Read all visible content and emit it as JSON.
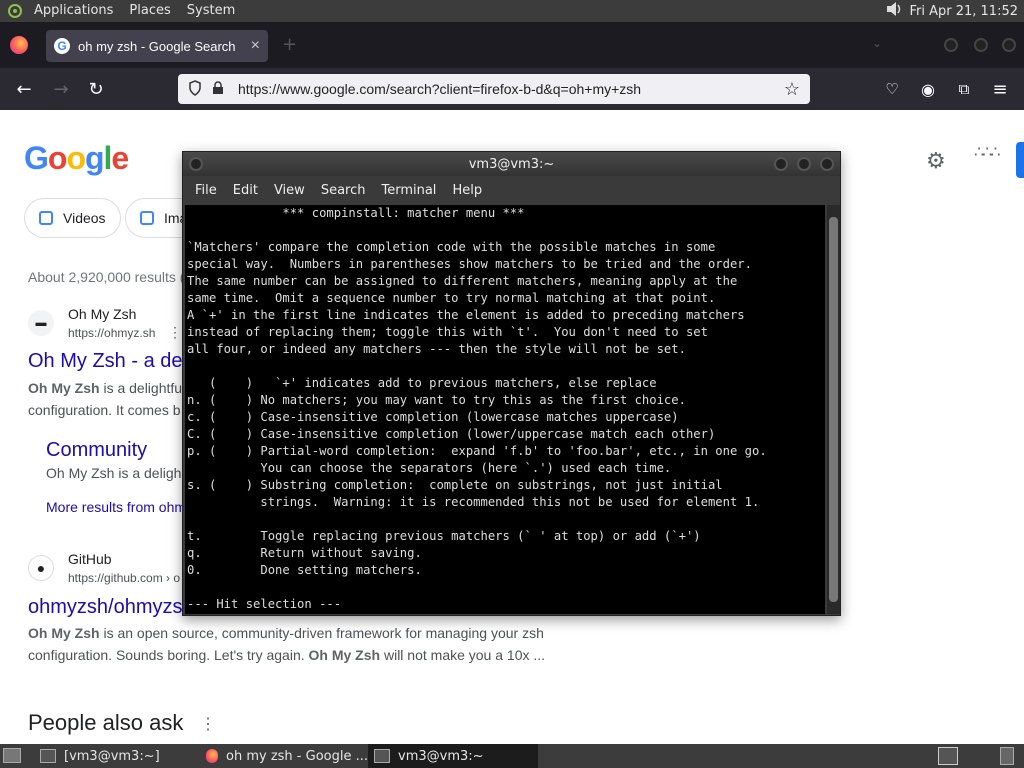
{
  "topbar": {
    "menus": [
      "Applications",
      "Places",
      "System"
    ],
    "clock": "Fri Apr 21, 11:52"
  },
  "browser": {
    "tab_title": "oh my zsh - Google Search",
    "url": "https://www.google.com/search?client=firefox-b-d&q=oh+my+zsh"
  },
  "google": {
    "logo": "Google",
    "chips": [
      "Videos",
      "Ima"
    ],
    "about": "About 2,920,000 results (",
    "result1": {
      "site_name": "Oh My Zsh",
      "site_url": "https://ohmyz.sh",
      "title": "Oh My Zsh - a de",
      "snippet_bold": "Oh My Zsh",
      "snippet_rest": " is a delightfu",
      "snippet_line2": "configuration. It comes b",
      "sublink_title": "Community",
      "sublink_snippet": "Oh My Zsh is a deligh",
      "more_results": "More results from ohm"
    },
    "result2": {
      "site_name": "GitHub",
      "site_url": "https://github.com › o",
      "title": "ohmyzsh/ohmyzs",
      "line1_bold": "Oh My Zsh",
      "line1_rest": " is an open source, community-driven framework for managing your zsh",
      "line2_a": "configuration. Sounds boring. Let's try again. ",
      "line2_bold": "Oh My Zsh",
      "line2_b": " will not make you a 10x ..."
    },
    "people_also_ask": "People also ask"
  },
  "terminal": {
    "title": "vm3@vm3:~",
    "menu": [
      "File",
      "Edit",
      "View",
      "Search",
      "Terminal",
      "Help"
    ],
    "lines": [
      "             *** compinstall: matcher menu ***",
      "",
      "`Matchers' compare the completion code with the possible matches in some",
      "special way.  Numbers in parentheses show matchers to be tried and the order.",
      "The same number can be assigned to different matchers, meaning apply at the",
      "same time.  Omit a sequence number to try normal matching at that point.",
      "A `+' in the first line indicates the element is added to preceding matchers",
      "instead of replacing them; toggle this with `t'.  You don't need to set",
      "all four, or indeed any matchers --- then the style will not be set.",
      "",
      "   (    )   `+' indicates add to previous matchers, else replace",
      "n. (    ) No matchers; you may want to try this as the first choice.",
      "c. (    ) Case-insensitive completion (lowercase matches uppercase)",
      "C. (    ) Case-insensitive completion (lower/uppercase match each other)",
      "p. (    ) Partial-word completion:  expand 'f.b' to 'foo.bar', etc., in one go.",
      "          You can choose the separators (here `.') used each time.",
      "s. (    ) Substring completion:  complete on substrings, not just initial",
      "          strings.  Warning: it is recommended this not be used for element 1.",
      "",
      "t.        Toggle replacing previous matchers (` ' at top) or add (`+')",
      "q.        Return without saving.",
      "0.        Done setting matchers.",
      "",
      "--- Hit selection ---"
    ]
  },
  "taskbar": {
    "tasks": [
      "[vm3@vm3:~]",
      "oh my zsh - Google ...",
      "vm3@vm3:~"
    ]
  },
  "colors": {
    "link": "#1a0dab",
    "panel": "#3c3c3c",
    "firefox_dark": "#1c1b22"
  }
}
